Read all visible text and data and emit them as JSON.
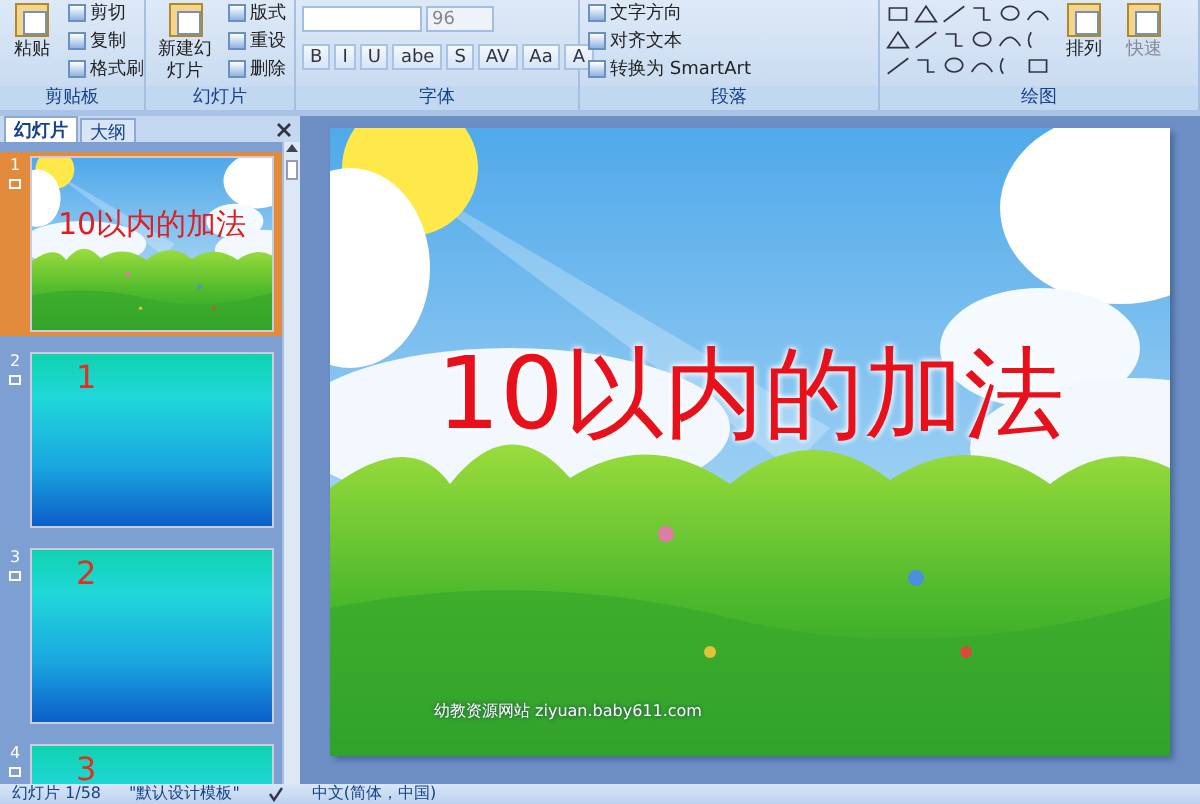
{
  "ribbon": {
    "groups": [
      {
        "label": "剪贴板",
        "items": [
          {
            "kind": "large",
            "label": "粘贴"
          },
          {
            "kind": "small",
            "label": "剪切"
          },
          {
            "kind": "small",
            "label": "复制"
          },
          {
            "kind": "small",
            "label": "格式刷"
          }
        ]
      },
      {
        "label": "幻灯片",
        "items": [
          {
            "kind": "large",
            "label": "新建幻灯片"
          },
          {
            "kind": "small",
            "label": "版式"
          },
          {
            "kind": "small",
            "label": "重设"
          },
          {
            "kind": "small",
            "label": "删除"
          }
        ]
      },
      {
        "label": "字体",
        "items": [
          {
            "kind": "combo",
            "value": "96"
          },
          {
            "kind": "format",
            "keys": [
              "B",
              "I",
              "U",
              "abe",
              "S",
              "AV",
              "Aa",
              "A"
            ]
          }
        ]
      },
      {
        "label": "段落",
        "items": [
          {
            "kind": "small",
            "label": "文字方向"
          },
          {
            "kind": "small",
            "label": "对齐文本"
          },
          {
            "kind": "small",
            "label": "转换为 SmartArt"
          }
        ]
      },
      {
        "label": "绘图",
        "items": [
          {
            "kind": "shapes"
          },
          {
            "kind": "large",
            "label": "排列"
          },
          {
            "kind": "fadedlarge",
            "label": "快速"
          }
        ]
      }
    ]
  },
  "panel": {
    "tabs": [
      {
        "label": "幻灯片",
        "selected": true
      },
      {
        "label": "大纲",
        "selected": false
      }
    ],
    "slides": [
      {
        "number": "1",
        "kind": "title",
        "text": "10以内的加法",
        "selected": true
      },
      {
        "number": "2",
        "kind": "plain",
        "text": "1",
        "selected": false
      },
      {
        "number": "3",
        "kind": "plain",
        "text": "2",
        "selected": false
      },
      {
        "number": "4",
        "kind": "plain",
        "text": "3",
        "selected": false
      }
    ]
  },
  "slide": {
    "title": "10以内的加法",
    "footer": "幼教资源网站  ziyuan.baby611.com"
  },
  "status_bar": [
    "幻灯片 1/58",
    "\"默认设计模板\"",
    "中文(简体，中国)"
  ]
}
